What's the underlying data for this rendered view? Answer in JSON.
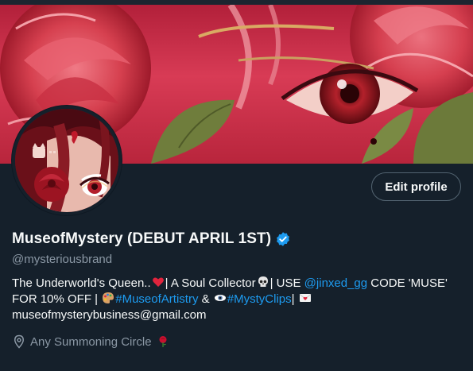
{
  "profile": {
    "display_name": "MuseofMystery (DEBUT APRIL 1ST)",
    "handle": "@mysteriousbrand",
    "verified": true,
    "edit_button_label": "Edit profile",
    "bio": {
      "line1_part1": "The Underworld's Queen..",
      "line1_emoji1": "heart-emoji",
      "line1_part2": "| A Soul Collector",
      "line1_emoji2": "skull-emoji",
      "line1_part3": "| USE ",
      "line1_link": "@jinxed_gg",
      "line1_part4": " CODE 'MUSE'",
      "line2_part1": "FOR 10% OFF | ",
      "line2_emoji1": "palette-emoji",
      "line2_hashtag1": "#MuseofArtistry",
      "line2_part2": " & ",
      "line2_emoji2": "eye-emoji",
      "line2_hashtag2": "#MystyClips",
      "line2_part3": "| ",
      "line2_emoji3": "love-letter-emoji",
      "line3": "museofmysterybusiness@gmail.com"
    },
    "location": "Any Summoning Circle",
    "location_emoji": "rose-emoji"
  },
  "colors": {
    "background": "#15202b",
    "text": "#f7f9f9",
    "muted": "#8b98a5",
    "link": "#1d9bf0",
    "verified": "#1d9bf0"
  }
}
